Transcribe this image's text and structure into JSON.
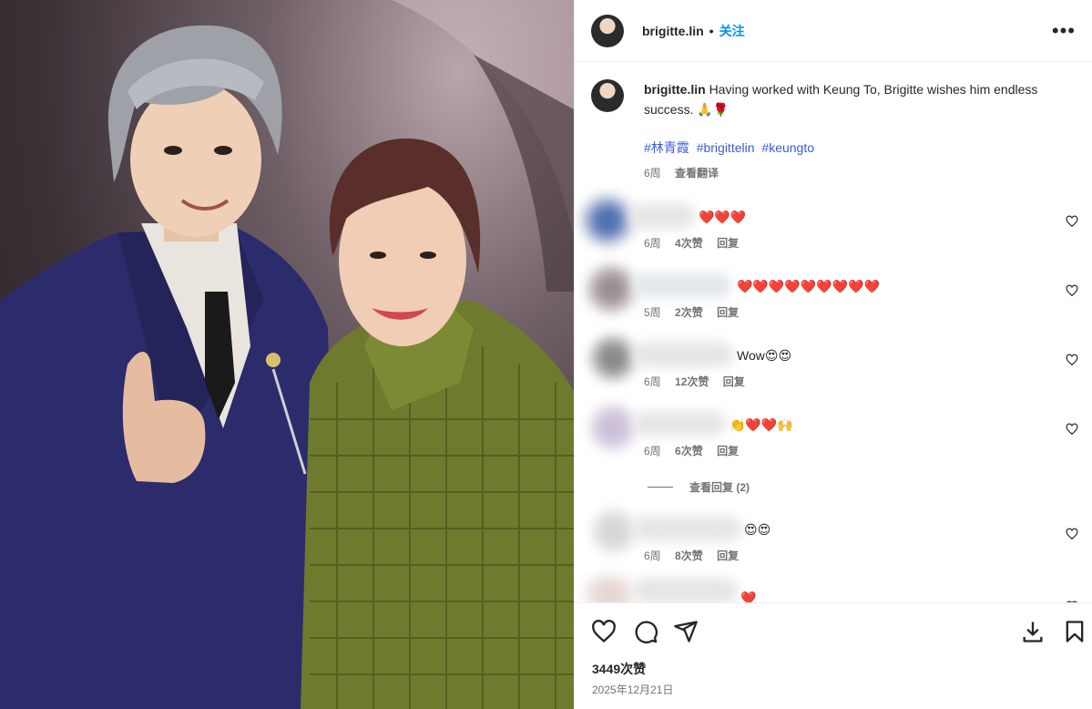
{
  "post": {
    "username": "brigitte.lin",
    "separator": "•",
    "follow_label": "关注",
    "more_label": "•••",
    "caption": "Having worked with Keung To, Brigitte wishes him endless success. 🙏🌹",
    "hashtags": [
      "#林青霞",
      "#brigittelin",
      "#keungto"
    ],
    "caption_time": "6周",
    "translate_label": "查看翻译"
  },
  "comments": [
    {
      "text": "❤️❤️❤️",
      "time": "6周",
      "likes": "4次赞",
      "reply": "回复"
    },
    {
      "text": "❤️❤️❤️❤️❤️❤️❤️❤️❤️",
      "time": "5周",
      "likes": "2次赞",
      "reply": "回复"
    },
    {
      "text": "Wow😍😍",
      "time": "6周",
      "likes": "12次赞",
      "reply": "回复"
    },
    {
      "text": "👏❤️❤️🙌",
      "time": "6周",
      "likes": "6次赞",
      "reply": "回复"
    },
    {
      "text": "😍😍",
      "time": "6周",
      "likes": "8次赞",
      "reply": "回复"
    },
    {
      "text": "❤️"
    }
  ],
  "view_replies_label": "查看回复 (2)",
  "footer": {
    "likes_count": "3449次赞",
    "date": "2025年12月21日"
  },
  "colors": {
    "accent": "#0095f6",
    "hashtag": "#3b5bdb",
    "muted": "#737373"
  }
}
